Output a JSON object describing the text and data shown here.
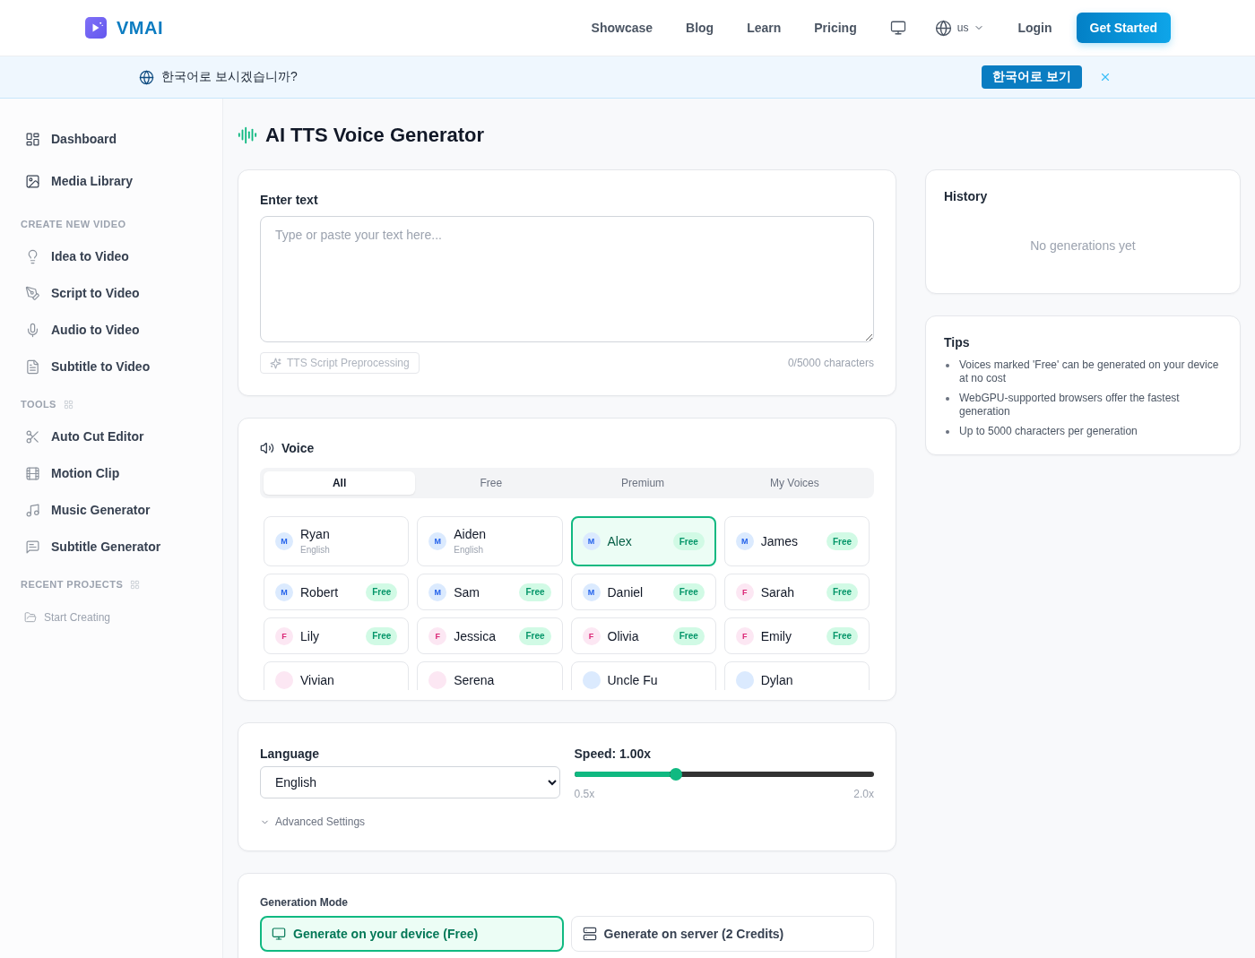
{
  "header": {
    "logo_text": "VMAI",
    "nav_links": [
      "Showcase",
      "Blog",
      "Learn",
      "Pricing"
    ],
    "region": "us",
    "login": "Login",
    "cta_button": "Get Started"
  },
  "language_banner": {
    "message": "한국어로 보시겠습니까?",
    "button": "한국어로 보기"
  },
  "sidebar": {
    "top_items": [
      "Dashboard",
      "Media Library"
    ],
    "sections": [
      {
        "title": "CREATE NEW VIDEO",
        "kind": "plain",
        "items": [
          "Idea to Video",
          "Script to Video",
          "Audio to Video",
          "Subtitle to Video"
        ]
      },
      {
        "title": "TOOLS",
        "kind": "grid",
        "items": [
          "Auto Cut Editor",
          "Motion Clip",
          "Music Generator",
          "Subtitle Generator"
        ]
      },
      {
        "title": "RECENT PROJECTS",
        "kind": "recent",
        "items": [
          "Start Creating"
        ]
      }
    ]
  },
  "page_title": "AI TTS Voice Generator",
  "text_input": {
    "label": "Enter text",
    "placeholder": "Type or paste your text here...",
    "preprocess_button": {
      "label": "TTS Script Preprocessing",
      "disabled": true
    },
    "counter": "0/5000 characters"
  },
  "voice": {
    "title": "Voice",
    "tabs": [
      {
        "label": "All",
        "selected": true
      },
      {
        "label": "Free",
        "selected": false
      },
      {
        "label": "Premium",
        "selected": false
      },
      {
        "label": "My Voices",
        "selected": false
      }
    ],
    "voices": [
      {
        "name": "Ryan",
        "avatar": "M",
        "color": "#dbeafe",
        "language": "English",
        "selected": false
      },
      {
        "name": "Aiden",
        "avatar": "M",
        "color": "#dbeafe",
        "language": "English",
        "selected": false
      },
      {
        "name": "Alex",
        "avatar": "M",
        "color": "#dbeafe",
        "badge": "Free",
        "selected": true
      },
      {
        "name": "James",
        "avatar": "M",
        "color": "#dbeafe",
        "badge": "Free",
        "selected": false
      },
      {
        "name": "Robert",
        "avatar": "M",
        "color": "#dbeafe",
        "badge": "Free",
        "selected": false
      },
      {
        "name": "Sam",
        "avatar": "M",
        "color": "#dbeafe",
        "badge": "Free",
        "selected": false
      },
      {
        "name": "Daniel",
        "avatar": "M",
        "color": "#dbeafe",
        "badge": "Free",
        "selected": false
      },
      {
        "name": "Sarah",
        "avatar": "F",
        "color": "#fce7f3",
        "badge": "Free",
        "selected": false
      },
      {
        "name": "Lily",
        "avatar": "F",
        "color": "#fce7f3",
        "badge": "Free",
        "selected": false
      },
      {
        "name": "Jessica",
        "avatar": "F",
        "color": "#fce7f3",
        "badge": "Free",
        "selected": false
      },
      {
        "name": "Olivia",
        "avatar": "F",
        "color": "#fce7f3",
        "badge": "Free",
        "selected": false
      },
      {
        "name": "Emily",
        "avatar": "F",
        "color": "#fce7f3",
        "badge": "Free",
        "selected": false
      },
      {
        "name": "Vivian",
        "color": "#fce7f3",
        "selected": false
      },
      {
        "name": "Serena",
        "color": "#fce7f3",
        "selected": false
      },
      {
        "name": "Uncle Fu",
        "color": "#dbeafe",
        "selected": false
      },
      {
        "name": "Dylan",
        "color": "#dbeafe",
        "selected": false
      }
    ]
  },
  "settings": {
    "language": {
      "label": "Language",
      "value": "English"
    },
    "speed": {
      "label": "Speed: 1.00x",
      "level": 0.34,
      "min_label": "0.5x",
      "max_label": "2.0x"
    },
    "advanced": {
      "label": "Advanced Settings",
      "expanded": false
    }
  },
  "generation_mode": {
    "label": "Generation Mode",
    "options": [
      {
        "label": "Generate on your device (Free)",
        "selected": true
      },
      {
        "label": "Generate on server (2 Credits)",
        "selected": false
      }
    ]
  },
  "history": {
    "title": "History",
    "empty_text": "No generations yet"
  },
  "tips": {
    "title": "Tips",
    "items": [
      "Voices marked 'Free' can be generated on your device at no cost",
      "WebGPU-supported browsers offer the fastest generation",
      "Up to 5000 characters per generation"
    ]
  }
}
